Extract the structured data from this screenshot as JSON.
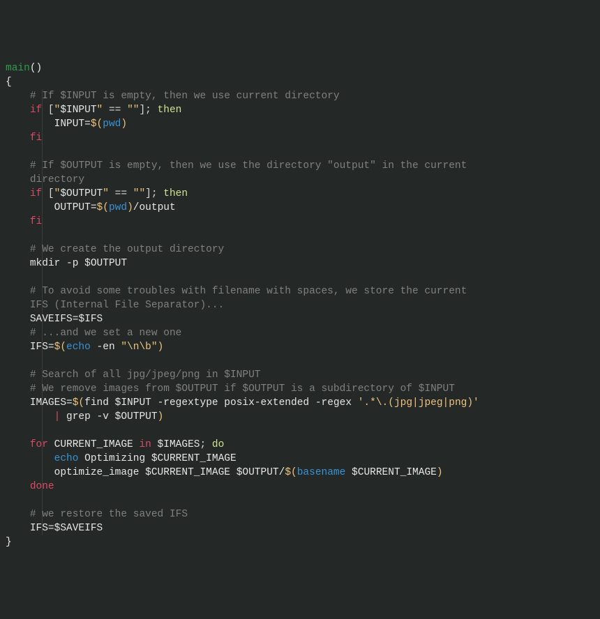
{
  "c": {
    "main": "main",
    "paren": "()",
    "lbrace": "{",
    "rbrace": "}",
    "cmt_input": "# If $INPUT is empty, then we use current directory",
    "if1_a": "if",
    "if1_b": " [",
    "if1_dq1": "\"",
    "if1_var1": "$INPUT",
    "if1_dq1b": "\"",
    "if1_mid": " == ",
    "if1_dq2": "\"\"",
    "if1_c": "]; ",
    "if1_then": "then",
    "input_assign_a": "INPUT=",
    "pwd_open": "$(",
    "pwd": "pwd",
    "pwd_close": ")",
    "fi": "fi",
    "cmt_output1": "# If $OUTPUT is empty, then we use the directory \"output\" in the current ",
    "cmt_output2": "directory",
    "if2_b": " [",
    "if2_dq1": "\"",
    "if2_var1": "$OUTPUT",
    "if2_dq1b": "\"",
    "if2_mid": " == ",
    "if2_dq2": "\"\"",
    "if2_c": "]; ",
    "output_assign_a": "OUTPUT=",
    "output_tail": "/output",
    "cmt_mkdir": "# We create the output directory",
    "mkdir_a": "mkdir -p ",
    "mkdir_var": "$OUTPUT",
    "cmt_ifs1": "# To avoid some troubles with filename with spaces, we store the current ",
    "cmt_ifs2": "IFS (Internal File Separator)...",
    "saveifs": "SAVEIFS=",
    "saveifs_v": "$IFS",
    "cmt_ifs3": "# ...and we set a new one",
    "ifs_a": "IFS=",
    "echo": "echo",
    "echo_args": " -en ",
    "echo_str": "\"\\n\\b\"",
    "cmt_search1": "# Search of all jpg/jpeg/png in $INPUT",
    "cmt_search2": "# We remove images from $OUTPUT if $OUTPUT is a subdirectory of $INPUT",
    "images_a": "IMAGES=",
    "find": "find",
    "find_args1": " ",
    "find_var1": "$INPUT",
    "find_args2": " -regextype posix-extended -regex ",
    "find_regex": "'.*\\.(jpg|jpeg|png)'",
    "pipe": " | ",
    "grep": "grep",
    "grep_args": " -v ",
    "grep_var": "$OUTPUT",
    "for": "for",
    "for_var": " CURRENT_IMAGE ",
    "in": "in",
    "for_var2": " $IMAGES",
    "semi_do": "; ",
    "do": "do",
    "opt_echo_args": " Optimizing ",
    "opt_var": "$CURRENT_IMAGE",
    "opt_call": "optimize_image ",
    "opt_var2": "$CURRENT_IMAGE",
    "opt_mid": " ",
    "opt_var3": "$OUTPUT",
    "opt_slash": "/",
    "basename": "basename",
    "basename_sp": " ",
    "basename_var": "$CURRENT_IMAGE",
    "done": "done",
    "cmt_restore": "# we restore the saved IFS",
    "restore": "IFS=",
    "restore_v": "$SAVEIFS"
  }
}
